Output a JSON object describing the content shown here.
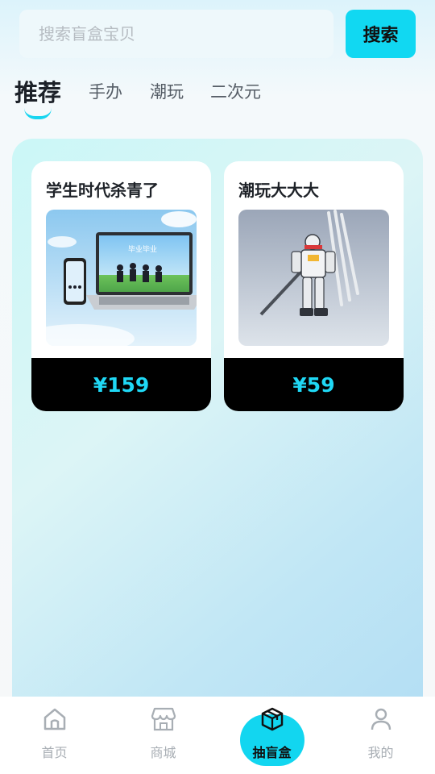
{
  "search": {
    "placeholder": "搜索盲盒宝贝",
    "button_label": "搜索"
  },
  "tabs": [
    {
      "label": "推荐",
      "active": true
    },
    {
      "label": "手办",
      "active": false
    },
    {
      "label": "潮玩",
      "active": false
    },
    {
      "label": "二次元",
      "active": false
    }
  ],
  "products": [
    {
      "title": "学生时代杀青了",
      "price": "¥159",
      "image": "laptop-and-phone-graduation-photo"
    },
    {
      "title": "潮玩大大大",
      "price": "¥59",
      "image": "gundam-robot-figure"
    }
  ],
  "bottom_nav": [
    {
      "label": "首页",
      "icon": "home-icon",
      "active": false
    },
    {
      "label": "商城",
      "icon": "store-icon",
      "active": false
    },
    {
      "label": "抽盲盒",
      "icon": "box-icon",
      "active": true
    },
    {
      "label": "我的",
      "icon": "user-icon",
      "active": false
    }
  ],
  "colors": {
    "accent": "#12d6f0",
    "price_text": "#1fd8f5",
    "price_bar": "#000000"
  }
}
